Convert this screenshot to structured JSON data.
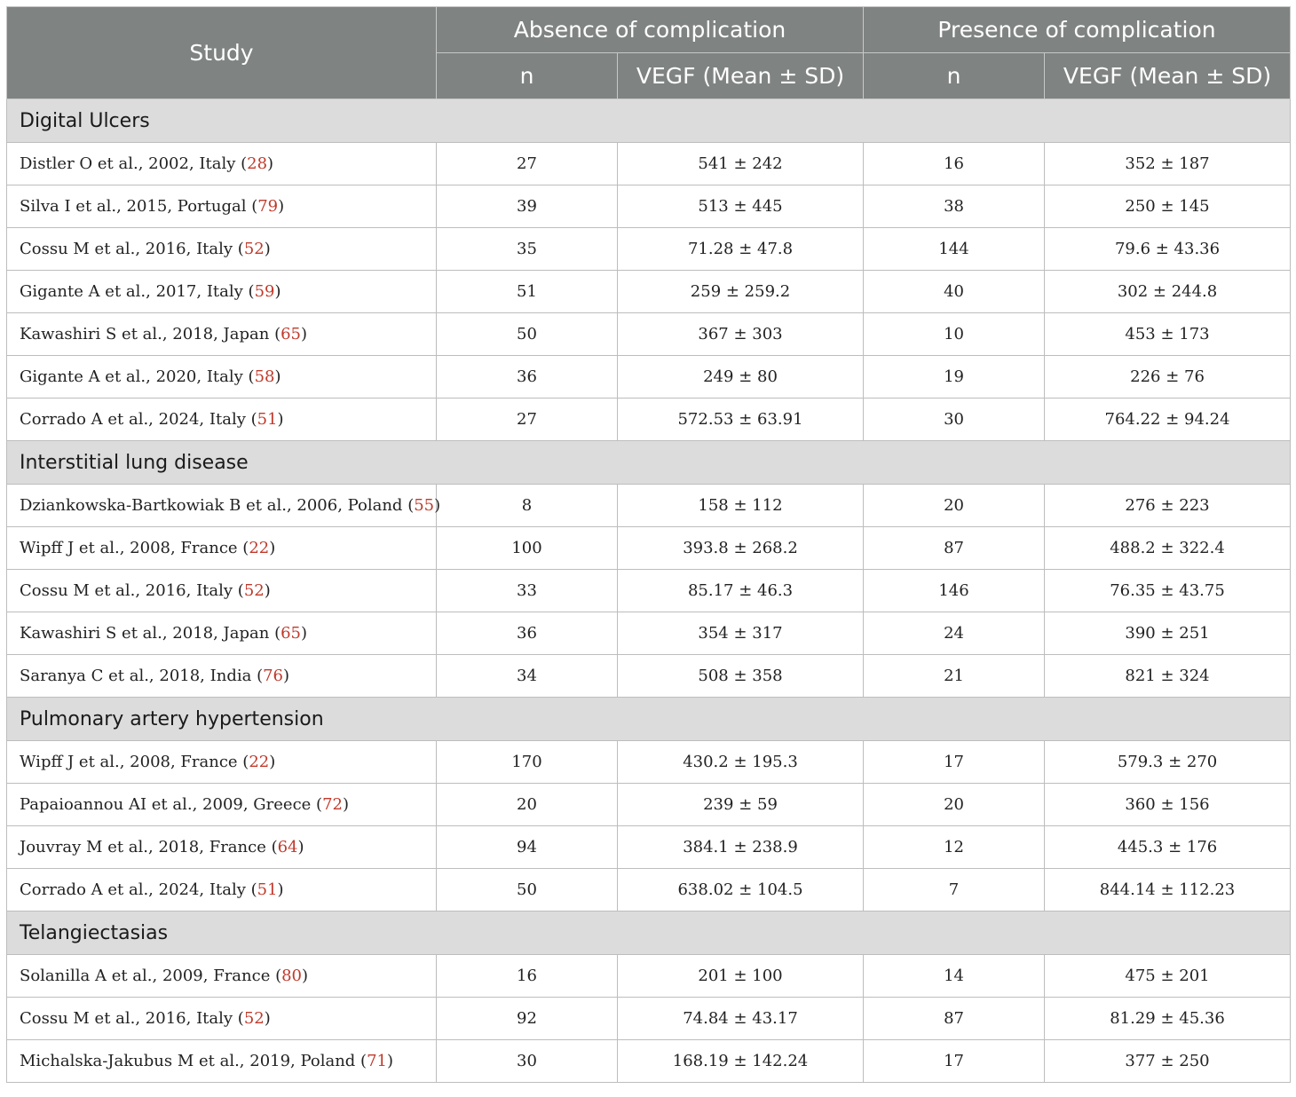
{
  "header": {
    "study": "Study",
    "absence": "Absence of complication",
    "presence": "Presence of complication",
    "n": "n",
    "vegf": "VEGF (Mean ± SD)"
  },
  "groups": [
    {
      "title": "Digital Ulcers",
      "rows": [
        {
          "study": "Distler O et al., 2002, Italy",
          "ref": "28",
          "n_abs": "27",
          "vegf_abs": "541 ± 242",
          "n_pres": "16",
          "vegf_pres": "352 ± 187"
        },
        {
          "study": "Silva I et al., 2015, Portugal",
          "ref": "79",
          "n_abs": "39",
          "vegf_abs": "513 ± 445",
          "n_pres": "38",
          "vegf_pres": "250 ± 145"
        },
        {
          "study": "Cossu M et al., 2016, Italy",
          "ref": "52",
          "n_abs": "35",
          "vegf_abs": "71.28 ± 47.8",
          "n_pres": "144",
          "vegf_pres": "79.6 ± 43.36"
        },
        {
          "study": "Gigante A et al., 2017, Italy",
          "ref": "59",
          "n_abs": "51",
          "vegf_abs": "259 ± 259.2",
          "n_pres": "40",
          "vegf_pres": "302 ± 244.8"
        },
        {
          "study": "Kawashiri S et al., 2018, Japan",
          "ref": "65",
          "n_abs": "50",
          "vegf_abs": "367 ± 303",
          "n_pres": "10",
          "vegf_pres": "453 ± 173"
        },
        {
          "study": "Gigante A et al., 2020, Italy",
          "ref": "58",
          "n_abs": "36",
          "vegf_abs": "249 ± 80",
          "n_pres": "19",
          "vegf_pres": "226 ± 76"
        },
        {
          "study": "Corrado A et al., 2024, Italy",
          "ref": "51",
          "n_abs": "27",
          "vegf_abs": "572.53 ± 63.91",
          "n_pres": "30",
          "vegf_pres": "764.22 ± 94.24"
        }
      ]
    },
    {
      "title": "Interstitial lung disease",
      "rows": [
        {
          "study": "Dziankowska-Bartkowiak B et al., 2006, Poland",
          "ref": "55",
          "n_abs": "8",
          "vegf_abs": "158 ± 112",
          "n_pres": "20",
          "vegf_pres": "276 ± 223"
        },
        {
          "study": "Wipff J et al., 2008, France",
          "ref": "22",
          "n_abs": "100",
          "vegf_abs": "393.8 ± 268.2",
          "n_pres": "87",
          "vegf_pres": "488.2 ± 322.4"
        },
        {
          "study": "Cossu M et al., 2016, Italy",
          "ref": "52",
          "n_abs": "33",
          "vegf_abs": "85.17 ± 46.3",
          "n_pres": "146",
          "vegf_pres": "76.35 ± 43.75"
        },
        {
          "study": "Kawashiri S et al., 2018, Japan",
          "ref": "65",
          "n_abs": "36",
          "vegf_abs": "354 ± 317",
          "n_pres": "24",
          "vegf_pres": "390 ± 251"
        },
        {
          "study": "Saranya C et al., 2018, India",
          "ref": "76",
          "n_abs": "34",
          "vegf_abs": "508 ± 358",
          "n_pres": "21",
          "vegf_pres": "821 ± 324"
        }
      ]
    },
    {
      "title": "Pulmonary artery hypertension",
      "rows": [
        {
          "study": "Wipff J et al., 2008, France",
          "ref": "22",
          "n_abs": "170",
          "vegf_abs": "430.2 ± 195.3",
          "n_pres": "17",
          "vegf_pres": "579.3 ± 270"
        },
        {
          "study": "Papaioannou AI et al., 2009, Greece",
          "ref": "72",
          "n_abs": "20",
          "vegf_abs": "239 ± 59",
          "n_pres": "20",
          "vegf_pres": "360 ± 156"
        },
        {
          "study": "Jouvray M et al., 2018, France",
          "ref": "64",
          "n_abs": "94",
          "vegf_abs": "384.1 ± 238.9",
          "n_pres": "12",
          "vegf_pres": "445.3 ± 176"
        },
        {
          "study": "Corrado A et al., 2024, Italy",
          "ref": "51",
          "n_abs": "50",
          "vegf_abs": "638.02 ± 104.5",
          "n_pres": "7",
          "vegf_pres": "844.14 ± 112.23"
        }
      ]
    },
    {
      "title": "Telangiectasias",
      "rows": [
        {
          "study": "Solanilla A et al., 2009, France",
          "ref": "80",
          "n_abs": "16",
          "vegf_abs": "201 ± 100",
          "n_pres": "14",
          "vegf_pres": "475 ± 201"
        },
        {
          "study": "Cossu M et al., 2016, Italy",
          "ref": "52",
          "n_abs": "92",
          "vegf_abs": "74.84 ± 43.17",
          "n_pres": "87",
          "vegf_pres": "81.29 ± 45.36"
        },
        {
          "study": "Michalska-Jakubus M et al., 2019, Poland",
          "ref": "71",
          "n_abs": "30",
          "vegf_abs": "168.19 ± 142.24",
          "n_pres": "17",
          "vegf_pres": "377 ± 250"
        }
      ]
    }
  ]
}
